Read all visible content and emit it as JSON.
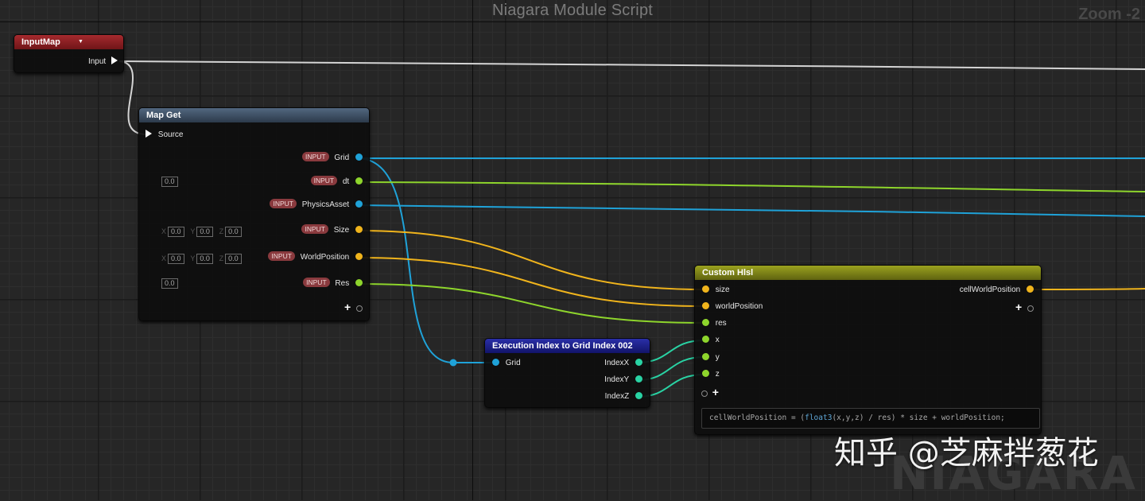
{
  "window": {
    "title": "Niagara Module Script",
    "zoom": "Zoom -2"
  },
  "colors": {
    "header_inputmap": "#8c1e22",
    "header_mapget": "#3e5066",
    "header_custom": "#85891a",
    "header_execindex": "#1a1d8c",
    "pin_grid": "#1fa2d8",
    "pin_float": "#8ed52c",
    "pin_vector": "#f0b41c",
    "pin_int": "#29d3a4",
    "wire_white": "#d4d4d4"
  },
  "nodes": {
    "input_map": {
      "title": "InputMap",
      "dropdown_icon": "chevron-down-icon",
      "out_pin": "Input"
    },
    "map_get": {
      "title": "Map Get",
      "source_pin": "Source",
      "badge": "INPUT",
      "pins": [
        {
          "label": "Grid",
          "type": "grid"
        },
        {
          "label": "dt",
          "type": "float",
          "default": "0.0"
        },
        {
          "label": "PhysicsAsset",
          "type": "grid"
        },
        {
          "label": "Size",
          "type": "vector",
          "x": "0.0",
          "y": "0.0",
          "z": "0.0"
        },
        {
          "label": "WorldPosition",
          "type": "vector",
          "x": "0.0",
          "y": "0.0",
          "z": "0.0"
        },
        {
          "label": "Res",
          "type": "float",
          "default": "0.0"
        }
      ],
      "axis_labels": {
        "x": "X",
        "y": "Y",
        "z": "Z"
      },
      "add_pin": "+"
    },
    "exec_index": {
      "title": "Execution Index to Grid Index 002",
      "in_pin": "Grid",
      "out_pins": [
        "IndexX",
        "IndexY",
        "IndexZ"
      ]
    },
    "custom_hlsl": {
      "title": "Custom Hlsl",
      "in_pins": [
        "size",
        "worldPosition",
        "res",
        "x",
        "y",
        "z"
      ],
      "out_pin": "cellWorldPosition",
      "add_pin": "+",
      "code": {
        "pre": "cellWorldPosition = (",
        "kw": "float3",
        "post": "(x,y,z) / res) * size + worldPosition;"
      }
    }
  },
  "watermark": "知乎 @芝麻拌葱花",
  "logo": "NIAGARA"
}
